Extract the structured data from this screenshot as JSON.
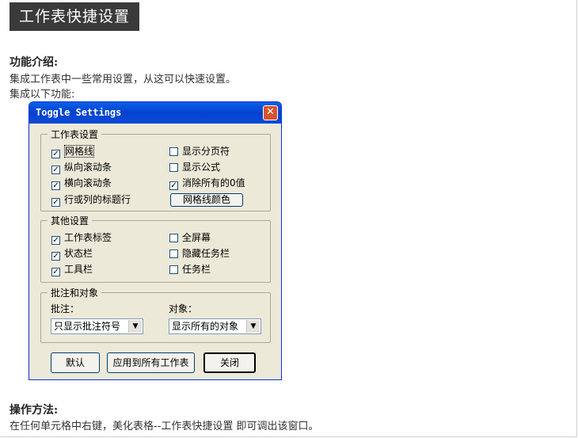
{
  "page_title": "工作表快捷设置",
  "intro": {
    "heading": "功能介绍:",
    "lines": [
      "集成工作表中一些常用设置，从这可以快速设置。",
      "集成以下功能:"
    ]
  },
  "dialog": {
    "title": "Toggle Settings",
    "close_glyph": "✕",
    "group1": {
      "legend": "工作表设置",
      "left": [
        {
          "label": "网格线",
          "checked": true
        },
        {
          "label": "纵向滚动条",
          "checked": true
        },
        {
          "label": "横向滚动条",
          "checked": true
        },
        {
          "label": "行或列的标题行",
          "checked": true
        }
      ],
      "right": [
        {
          "label": "显示分页符",
          "checked": false
        },
        {
          "label": "显示公式",
          "checked": false
        },
        {
          "label": "消除所有的0值",
          "checked": true
        }
      ],
      "color_button": "网格线颜色"
    },
    "group2": {
      "legend": "其他设置",
      "left": [
        {
          "label": "工作表标签",
          "checked": true
        },
        {
          "label": "状态栏",
          "checked": true
        },
        {
          "label": "工具栏",
          "checked": true
        }
      ],
      "right": [
        {
          "label": "全屏幕",
          "checked": false
        },
        {
          "label": "隐藏任务栏",
          "checked": false
        },
        {
          "label": "任务栏",
          "checked": false
        }
      ]
    },
    "group3": {
      "legend": "批注和对象",
      "comment_label": "批注：",
      "comment_value": "只显示批注符号",
      "object_label": "对象：",
      "object_value": "显示所有的对象"
    },
    "buttons": {
      "default": "默认",
      "apply_all": "应用到所有工作表",
      "close": "关闭"
    },
    "check_glyph": "✓"
  },
  "usage": {
    "heading": "操作方法:",
    "line": "在任何单元格中右键，美化表格--工作表快捷设置 即可调出该窗口。"
  }
}
